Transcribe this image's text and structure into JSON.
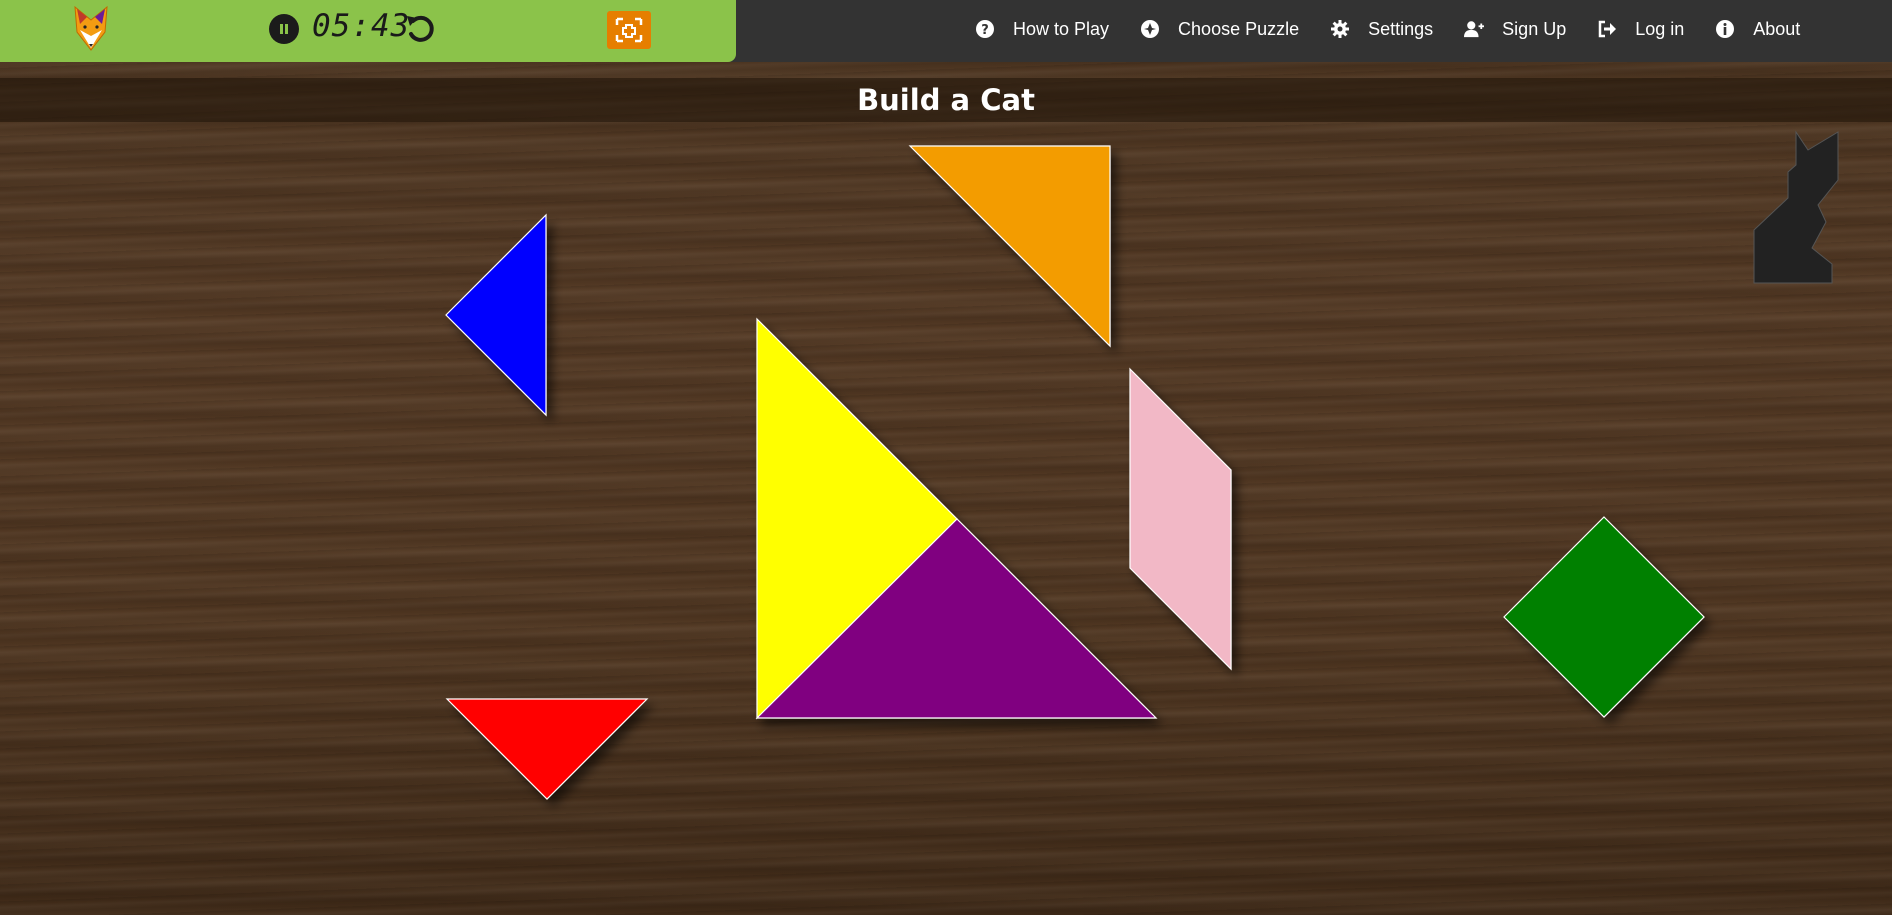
{
  "game": {
    "timer": "05:43",
    "pause_label": "pause",
    "undo_icon": "undo-icon",
    "fullscreen_icon": "fullscreen-icon",
    "colors": {
      "bar": "#8bc34a",
      "fullscreen": "#e67e00",
      "topbar": "#333333"
    }
  },
  "nav": {
    "items": [
      {
        "label": "How to Play",
        "icon": "question-circle-icon"
      },
      {
        "label": "Choose Puzzle",
        "icon": "puzzle-icon"
      },
      {
        "label": "Settings",
        "icon": "gear-icon"
      },
      {
        "label": "Sign Up",
        "icon": "user-plus-icon"
      },
      {
        "label": "Log in",
        "icon": "sign-in-icon"
      },
      {
        "label": "About",
        "icon": "info-circle-icon"
      }
    ]
  },
  "puzzle": {
    "title": "Build a Cat",
    "target_color": "#222222",
    "pieces": [
      {
        "name": "blue-small-triangle",
        "color": "#0000ff"
      },
      {
        "name": "orange-medium-triangle",
        "color": "#f39c00"
      },
      {
        "name": "yellow-large-triangle",
        "color": "#ffff00"
      },
      {
        "name": "purple-large-triangle",
        "color": "#800080"
      },
      {
        "name": "pink-parallelogram",
        "color": "#f2b8c6"
      },
      {
        "name": "green-square",
        "color": "#008000"
      },
      {
        "name": "red-small-triangle",
        "color": "#ff0000"
      }
    ]
  }
}
